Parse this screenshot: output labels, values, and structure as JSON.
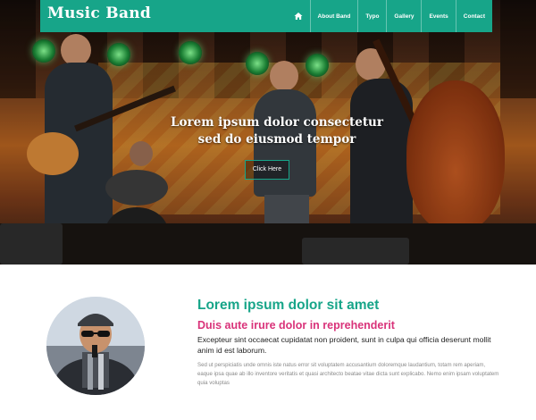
{
  "navbar": {
    "brand": "Music Band",
    "items": [
      {
        "label": "About Band"
      },
      {
        "label": "Typo"
      },
      {
        "label": "Gallery"
      },
      {
        "label": "Events"
      },
      {
        "label": "Contact"
      }
    ],
    "home_icon": "home-icon"
  },
  "hero": {
    "headline_line1": "Lorem ipsum dolor consectetur",
    "headline_line2": "sed do eiusmod tempor",
    "cta_label": "Click Here"
  },
  "section": {
    "title": "Lorem ipsum dolor sit amet",
    "subtitle": "Duis aute irure dolor in reprehenderit",
    "lead": "Excepteur sint occaecat cupidatat non proident, sunt in culpa qui officia deserunt mollit anim id est laborum.",
    "body": "Sed ut perspiciatis unde omnis iste natus error sit voluptatem accusantium doloremque laudantium, totam rem aperiam, eaque ipsa quae ab illo inventore veritatis et quasi architecto beatae vitae dicta sunt explicabo. Nemo enim ipsam voluptatem quia voluptas"
  },
  "colors": {
    "accent": "#17a589",
    "highlight": "#d9337a"
  }
}
